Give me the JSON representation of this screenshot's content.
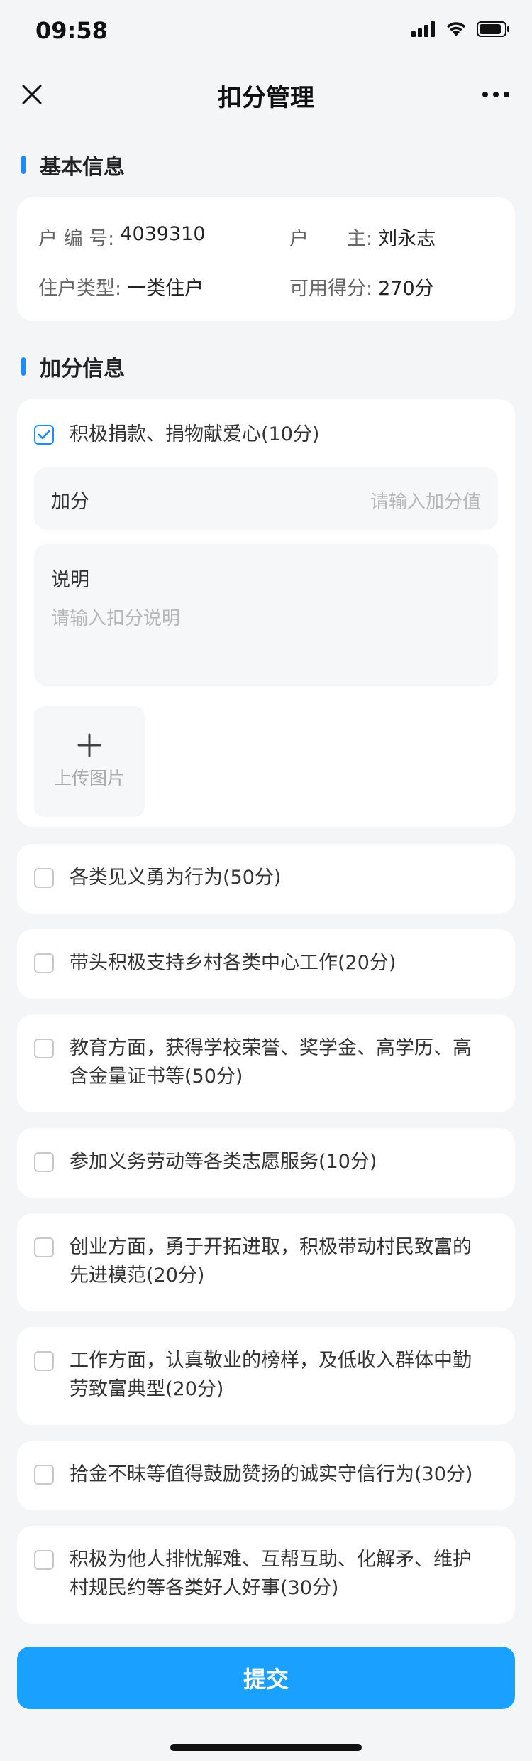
{
  "status_bar": {
    "time": "09:58"
  },
  "nav": {
    "title": "扣分管理"
  },
  "basic": {
    "section_title": "基本信息",
    "household_no_label": "户 编 号:",
    "household_no": "4039310",
    "head_label": "户　　主:",
    "head": "刘永志",
    "type_label": "住户类型:",
    "type": "一类住户",
    "score_label": "可用得分:",
    "score": "270分"
  },
  "bonus": {
    "section_title": "加分信息",
    "selected": {
      "label": "积极捐款、捐物献爱心(10分)",
      "add_label": "加分",
      "add_placeholder": "请输入加分值",
      "desc_label": "说明",
      "desc_placeholder": "请输入扣分说明",
      "upload_label": "上传图片"
    },
    "options": [
      "各类见义勇为行为(50分)",
      "带头积极支持乡村各类中心工作(20分)",
      "教育方面，获得学校荣誉、奖学金、高学历、高含金量证书等(50分)",
      "参加义务劳动等各类志愿服务(10分)",
      "创业方面，勇于开拓进取，积极带动村民致富的先进模范(20分)",
      "工作方面，认真敬业的榜样，及低收入群体中勤劳致富典型(20分)",
      "拾金不昧等值得鼓励赞扬的诚实守信行为(30分)",
      "积极为他人排忧解难、互帮互助、化解矛、维护村规民约等各类好人好事(30分)"
    ]
  },
  "submit_label": "提交",
  "colors": {
    "accent": "#1a8cff",
    "button": "#1aa0ff"
  }
}
